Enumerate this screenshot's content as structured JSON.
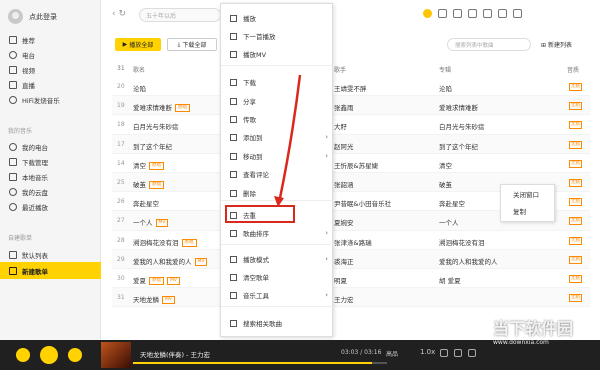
{
  "sidebar": {
    "login_label": "点此登录",
    "items_top": [
      {
        "label": "推荐",
        "icon": "home-icon"
      },
      {
        "label": "电台",
        "icon": "radio-icon"
      },
      {
        "label": "视频",
        "icon": "video-icon"
      },
      {
        "label": "直播",
        "icon": "live-icon"
      },
      {
        "label": "HiFi发烧音乐",
        "icon": "hifi-icon"
      }
    ],
    "section_mine": "我的音乐",
    "items_mine": [
      {
        "label": "我的电台",
        "icon": "radio-icon"
      },
      {
        "label": "下载管理",
        "icon": "download-icon"
      },
      {
        "label": "本地音乐",
        "icon": "computer-icon"
      },
      {
        "label": "我的云盘",
        "icon": "cloud-icon"
      },
      {
        "label": "最近播放",
        "icon": "clock-icon"
      }
    ],
    "section_created": "自建歌单",
    "items_created": [
      {
        "label": "默认列表",
        "icon": "list-icon"
      },
      {
        "label": "新建歌单",
        "icon": "list-icon",
        "active": true
      }
    ]
  },
  "header": {
    "search_placeholder": "五十年以后"
  },
  "toolbar": {
    "play_all": "播放全部",
    "download_all": "下载全部",
    "search_list_placeholder": "搜索列表中歌曲",
    "new_list": "新建列表"
  },
  "table": {
    "headers": {
      "num": "31",
      "title": "歌名",
      "singer": "歌手",
      "album": "专辑",
      "quality": "音质"
    },
    "rows": [
      {
        "num": "20",
        "title": "沦陷",
        "tags": [],
        "singer": "王靖雯不胖",
        "album": "沦陷",
        "q": "无损"
      },
      {
        "num": "19",
        "title": "爱难求情难断",
        "tags": [
          "原唱"
        ],
        "singer": "张鑫雨",
        "album": "爱难求情难断",
        "q": "无损"
      },
      {
        "num": "18",
        "title": "白月光与朱砂痣",
        "tags": [],
        "singer": "大籽",
        "album": "白月光与朱砂痣",
        "q": "无损"
      },
      {
        "num": "17",
        "title": "到了这个年纪",
        "tags": [],
        "singer": "赵阿光",
        "album": "到了这个年纪",
        "q": "无损"
      },
      {
        "num": "14",
        "title": "清空",
        "tags": [
          "原唱"
        ],
        "singer": "王忻辰&苏星婕",
        "album": "清空",
        "q": "无损"
      },
      {
        "num": "25",
        "title": "破茧",
        "tags": [
          "原唱"
        ],
        "singer": "张韶涵",
        "album": "破茧",
        "q": "无损"
      },
      {
        "num": "26",
        "title": "奔赴星空",
        "tags": [],
        "singer": "尹昔眠&小田音乐社",
        "album": "奔赴星空",
        "q": "无损"
      },
      {
        "num": "27",
        "title": "一个人",
        "tags": [
          "MV"
        ],
        "singer": "夏婉安",
        "album": "一个人",
        "q": "无损"
      },
      {
        "num": "28",
        "title": "溯洄梅花没有泪",
        "tags": [
          "原唱"
        ],
        "singer": "张津涤&路瑞",
        "album": "溯洄梅花没有泪",
        "q": "无损"
      },
      {
        "num": "29",
        "title": "爱我的人和我爱的人",
        "tags": [
          "MV"
        ],
        "singer": "裘海正",
        "album": "爱我的人和我爱的人",
        "q": "无损"
      },
      {
        "num": "30",
        "title": "爱夏",
        "tags": [
          "原唱",
          "MV"
        ],
        "singer": "明夏",
        "album": "胡 爱夏",
        "q": "无损"
      },
      {
        "num": "31",
        "title": "天地龙鳞",
        "tags": [
          "MV"
        ],
        "singer": "王力宏",
        "album": "",
        "q": "无损"
      }
    ]
  },
  "context_menu": {
    "items": [
      {
        "label": "播放",
        "icon": "play-icon",
        "submenu": false
      },
      {
        "label": "下一首播放",
        "icon": "next-play-icon",
        "submenu": false
      },
      {
        "label": "播放MV",
        "icon": "mv-icon",
        "submenu": false
      },
      {
        "label": "下载",
        "icon": "download-icon",
        "submenu": false
      },
      {
        "label": "分享",
        "icon": "share-icon",
        "submenu": false
      },
      {
        "label": "传歌",
        "icon": "transfer-icon",
        "submenu": false
      },
      {
        "label": "添加到",
        "icon": "add-icon",
        "submenu": true
      },
      {
        "label": "移动到",
        "icon": "move-icon",
        "submenu": true
      },
      {
        "label": "查看评论",
        "icon": "comment-icon",
        "submenu": false
      },
      {
        "label": "删除",
        "icon": "trash-icon",
        "submenu": false
      },
      {
        "label": "去重",
        "icon": "dedupe-icon",
        "submenu": false,
        "highlighted": true
      },
      {
        "label": "歌曲排序",
        "icon": "sort-icon",
        "submenu": true
      },
      {
        "label": "播放模式",
        "icon": "mode-icon",
        "submenu": true
      },
      {
        "label": "清空歌单",
        "icon": "clear-icon",
        "submenu": false
      },
      {
        "label": "音乐工具",
        "icon": "tools-icon",
        "submenu": true
      },
      {
        "label": "搜索相关歌曲",
        "icon": "search-icon",
        "submenu": false
      }
    ]
  },
  "popup": {
    "items": [
      "关闭窗口",
      "复制"
    ]
  },
  "player": {
    "now_playing": "天地龙鳞(伴奏) - 王力宏",
    "time": "03:03 / 03:16",
    "quality": "高品",
    "rate": "1.0x",
    "progress": 0.94
  },
  "watermark": {
    "title": "当下软件园",
    "sub": "www.downxia.com"
  }
}
